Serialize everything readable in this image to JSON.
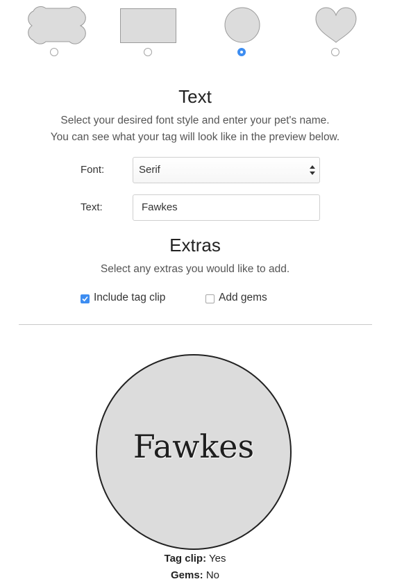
{
  "shape_picker": {
    "options": [
      {
        "name": "bone",
        "selected": false
      },
      {
        "name": "rectangle",
        "selected": false
      },
      {
        "name": "circle",
        "selected": true
      },
      {
        "name": "heart",
        "selected": false
      }
    ],
    "shape_fill": "#dcdcdc",
    "shape_stroke": "#9a9a9a",
    "radio_accent": "#3d8df1"
  },
  "text_section": {
    "heading": "Text",
    "description_line1": "Select your desired font style and enter your pet's name.",
    "description_line2": "You can see what your tag will look like in the preview below.",
    "font_label": "Font:",
    "font_value": "Serif",
    "text_label": "Text:",
    "text_value": "Fawkes"
  },
  "extras_section": {
    "heading": "Extras",
    "description": "Select any extras you would like to add.",
    "options": [
      {
        "label": "Include tag clip",
        "checked": true
      },
      {
        "label": "Add gems",
        "checked": false
      }
    ]
  },
  "preview": {
    "tag_text": "Fawkes",
    "tag_color": "#dcdcdc",
    "summary": {
      "clip_label": "Tag clip:",
      "clip_value": "Yes",
      "gems_label": "Gems:",
      "gems_value": "No"
    }
  }
}
